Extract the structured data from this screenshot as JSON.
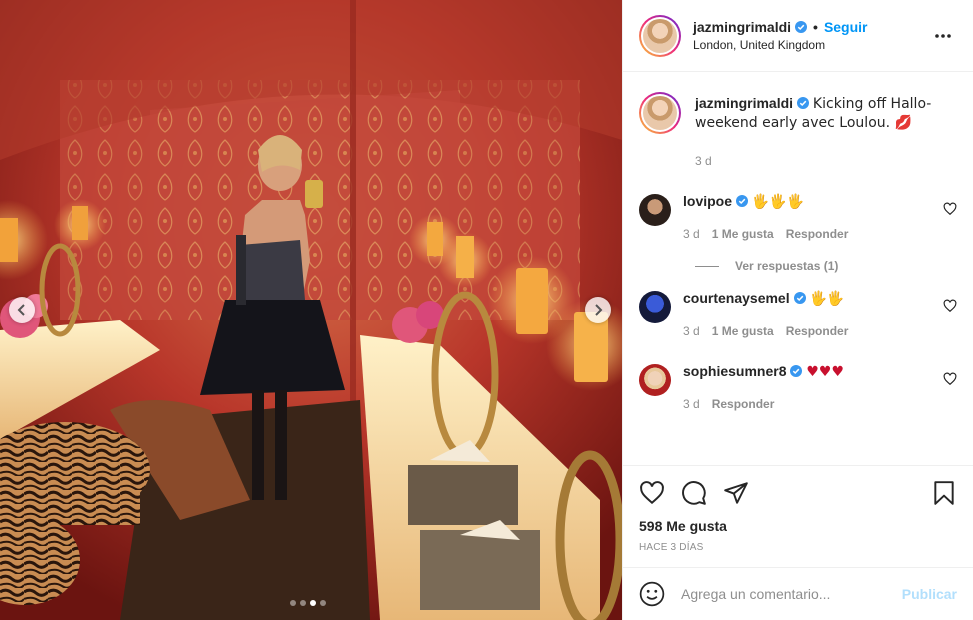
{
  "post": {
    "username": "jazmingrimaldi",
    "follow_label": "Seguir",
    "separator": "•",
    "location": "London, United Kingdom",
    "caption_text": "Kicking off Hallo-weekend early avec Loulou. 💋",
    "caption_time": "3 d"
  },
  "comments": [
    {
      "username": "lovipoe",
      "text": "🖐🖐🖐",
      "time": "3 d",
      "likes": "1 Me gusta",
      "reply": "Responder"
    },
    {
      "username": "courtenaysemel",
      "text": "🖐🖐",
      "time": "3 d",
      "likes": "1 Me gusta",
      "reply": "Responder"
    },
    {
      "username": "sophiesumner8",
      "text": "♥♥♥",
      "time": "3 d",
      "likes": "",
      "reply": "Responder"
    }
  ],
  "replies_label": "Ver respuestas (1)",
  "likes_count": "598 Me gusta",
  "posted_ago": "HACE 3 DÍAS",
  "comment_box": {
    "placeholder": "Agrega un comentario...",
    "publish_label": "Publicar"
  },
  "carousel": {
    "total": 4,
    "active_index": 2
  },
  "colors": {
    "accent": "#0095f6",
    "verified": "#3897f0",
    "publish_disabled": "#b2dffc",
    "heart": "#c8102e"
  }
}
